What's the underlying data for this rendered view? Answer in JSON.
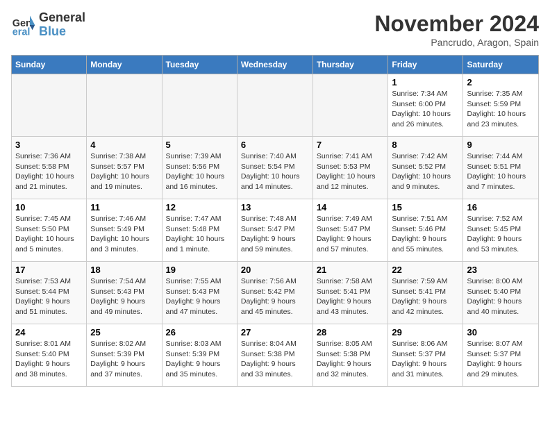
{
  "header": {
    "logo_line1": "General",
    "logo_line2": "Blue",
    "month_title": "November 2024",
    "location": "Pancrudo, Aragon, Spain"
  },
  "weekdays": [
    "Sunday",
    "Monday",
    "Tuesday",
    "Wednesday",
    "Thursday",
    "Friday",
    "Saturday"
  ],
  "weeks": [
    [
      {
        "day": "",
        "info": ""
      },
      {
        "day": "",
        "info": ""
      },
      {
        "day": "",
        "info": ""
      },
      {
        "day": "",
        "info": ""
      },
      {
        "day": "",
        "info": ""
      },
      {
        "day": "1",
        "info": "Sunrise: 7:34 AM\nSunset: 6:00 PM\nDaylight: 10 hours and 26 minutes."
      },
      {
        "day": "2",
        "info": "Sunrise: 7:35 AM\nSunset: 5:59 PM\nDaylight: 10 hours and 23 minutes."
      }
    ],
    [
      {
        "day": "3",
        "info": "Sunrise: 7:36 AM\nSunset: 5:58 PM\nDaylight: 10 hours and 21 minutes."
      },
      {
        "day": "4",
        "info": "Sunrise: 7:38 AM\nSunset: 5:57 PM\nDaylight: 10 hours and 19 minutes."
      },
      {
        "day": "5",
        "info": "Sunrise: 7:39 AM\nSunset: 5:56 PM\nDaylight: 10 hours and 16 minutes."
      },
      {
        "day": "6",
        "info": "Sunrise: 7:40 AM\nSunset: 5:54 PM\nDaylight: 10 hours and 14 minutes."
      },
      {
        "day": "7",
        "info": "Sunrise: 7:41 AM\nSunset: 5:53 PM\nDaylight: 10 hours and 12 minutes."
      },
      {
        "day": "8",
        "info": "Sunrise: 7:42 AM\nSunset: 5:52 PM\nDaylight: 10 hours and 9 minutes."
      },
      {
        "day": "9",
        "info": "Sunrise: 7:44 AM\nSunset: 5:51 PM\nDaylight: 10 hours and 7 minutes."
      }
    ],
    [
      {
        "day": "10",
        "info": "Sunrise: 7:45 AM\nSunset: 5:50 PM\nDaylight: 10 hours and 5 minutes."
      },
      {
        "day": "11",
        "info": "Sunrise: 7:46 AM\nSunset: 5:49 PM\nDaylight: 10 hours and 3 minutes."
      },
      {
        "day": "12",
        "info": "Sunrise: 7:47 AM\nSunset: 5:48 PM\nDaylight: 10 hours and 1 minute."
      },
      {
        "day": "13",
        "info": "Sunrise: 7:48 AM\nSunset: 5:47 PM\nDaylight: 9 hours and 59 minutes."
      },
      {
        "day": "14",
        "info": "Sunrise: 7:49 AM\nSunset: 5:47 PM\nDaylight: 9 hours and 57 minutes."
      },
      {
        "day": "15",
        "info": "Sunrise: 7:51 AM\nSunset: 5:46 PM\nDaylight: 9 hours and 55 minutes."
      },
      {
        "day": "16",
        "info": "Sunrise: 7:52 AM\nSunset: 5:45 PM\nDaylight: 9 hours and 53 minutes."
      }
    ],
    [
      {
        "day": "17",
        "info": "Sunrise: 7:53 AM\nSunset: 5:44 PM\nDaylight: 9 hours and 51 minutes."
      },
      {
        "day": "18",
        "info": "Sunrise: 7:54 AM\nSunset: 5:43 PM\nDaylight: 9 hours and 49 minutes."
      },
      {
        "day": "19",
        "info": "Sunrise: 7:55 AM\nSunset: 5:43 PM\nDaylight: 9 hours and 47 minutes."
      },
      {
        "day": "20",
        "info": "Sunrise: 7:56 AM\nSunset: 5:42 PM\nDaylight: 9 hours and 45 minutes."
      },
      {
        "day": "21",
        "info": "Sunrise: 7:58 AM\nSunset: 5:41 PM\nDaylight: 9 hours and 43 minutes."
      },
      {
        "day": "22",
        "info": "Sunrise: 7:59 AM\nSunset: 5:41 PM\nDaylight: 9 hours and 42 minutes."
      },
      {
        "day": "23",
        "info": "Sunrise: 8:00 AM\nSunset: 5:40 PM\nDaylight: 9 hours and 40 minutes."
      }
    ],
    [
      {
        "day": "24",
        "info": "Sunrise: 8:01 AM\nSunset: 5:40 PM\nDaylight: 9 hours and 38 minutes."
      },
      {
        "day": "25",
        "info": "Sunrise: 8:02 AM\nSunset: 5:39 PM\nDaylight: 9 hours and 37 minutes."
      },
      {
        "day": "26",
        "info": "Sunrise: 8:03 AM\nSunset: 5:39 PM\nDaylight: 9 hours and 35 minutes."
      },
      {
        "day": "27",
        "info": "Sunrise: 8:04 AM\nSunset: 5:38 PM\nDaylight: 9 hours and 33 minutes."
      },
      {
        "day": "28",
        "info": "Sunrise: 8:05 AM\nSunset: 5:38 PM\nDaylight: 9 hours and 32 minutes."
      },
      {
        "day": "29",
        "info": "Sunrise: 8:06 AM\nSunset: 5:37 PM\nDaylight: 9 hours and 31 minutes."
      },
      {
        "day": "30",
        "info": "Sunrise: 8:07 AM\nSunset: 5:37 PM\nDaylight: 9 hours and 29 minutes."
      }
    ]
  ]
}
